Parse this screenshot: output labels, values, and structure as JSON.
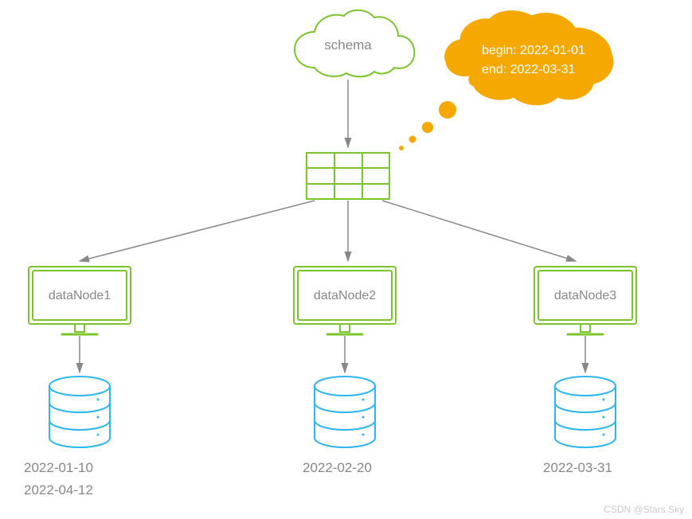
{
  "schema": {
    "label": "schema"
  },
  "thought": {
    "line1": "begin: 2022-01-01",
    "line2": "end: 2022-03-31"
  },
  "nodes": {
    "n1": {
      "label": "dataNode1",
      "dates": [
        "2022-01-10",
        "2022-04-12"
      ]
    },
    "n2": {
      "label": "dataNode2",
      "dates": [
        "2022-02-20"
      ]
    },
    "n3": {
      "label": "dataNode3",
      "dates": [
        "2022-03-31"
      ]
    }
  },
  "colors": {
    "green": "#7cc42b",
    "orange": "#f5a800",
    "blue": "#2db6f0",
    "text": "#888888",
    "gray": "#999999"
  },
  "watermark": "CSDN @Stars.Sky"
}
